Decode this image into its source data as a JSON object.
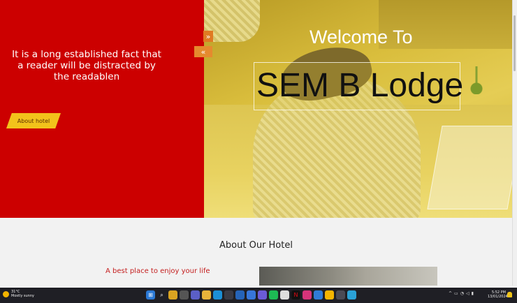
{
  "hero": {
    "left_text": "It is a long established fact that a reader will be distracted by the readablen",
    "about_button": "About hotel",
    "welcome": "Welcome To",
    "brand": "SEM B Lodge",
    "next_symbol": "»",
    "prev_symbol": "«",
    "colors": {
      "red_panel": "#cc0000",
      "button": "#f2c21b",
      "nav": "#e07a22"
    }
  },
  "about": {
    "title": "About Our Hotel",
    "tagline": "A best place to enjoy your life"
  },
  "taskbar": {
    "weather_temp": "31°C",
    "weather_desc": "Mostly sunny",
    "time": "5:52 PM",
    "date": "13/01/2024",
    "icons": [
      "windows-icon",
      "search-icon",
      "widgets-icon",
      "task-view-icon",
      "teams-icon",
      "file-explorer-icon",
      "edge-icon",
      "store-icon",
      "mail-icon",
      "calendar-icon",
      "app-icon",
      "spotify-icon",
      "app-icon-2",
      "netflix-icon",
      "instagram-icon",
      "app-icon-3",
      "chrome-icon",
      "app-icon-4",
      "app-icon-5"
    ]
  }
}
